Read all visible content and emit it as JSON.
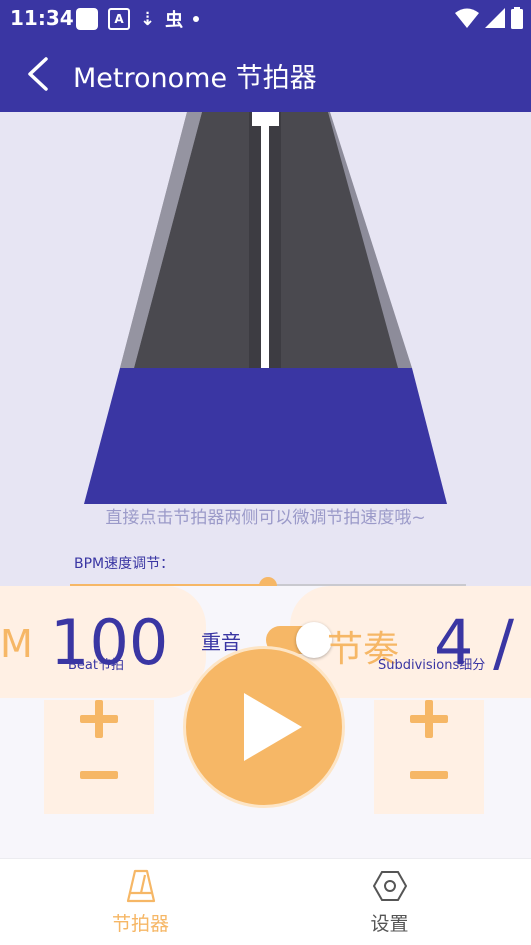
{
  "status_bar": {
    "time": "11:34",
    "a_badge": "A",
    "download_glyph": "⇣",
    "bug_glyph": "虫"
  },
  "app_bar": {
    "title": "Metronome 节拍器"
  },
  "hint": "直接点击节拍器两侧可以微调节拍速度哦~",
  "bpm_slider": {
    "label": "BPM速度调节：",
    "value": 0.5
  },
  "tempo": {
    "unit": "M",
    "value": "100",
    "label": "Beat节拍"
  },
  "accent": {
    "label": "重音",
    "enabled": true
  },
  "rhythm": {
    "label": "节奏",
    "value": "4 /",
    "sub_label": "Subdivisions细分"
  },
  "nav": [
    {
      "label": "节拍器",
      "icon": "metronome-icon",
      "active": true
    },
    {
      "label": "设置",
      "icon": "settings-hex-icon",
      "active": false
    }
  ],
  "colors": {
    "primary": "#3a36a3",
    "accent": "#f6b766",
    "card": "#fff0e4",
    "metronome_bg": "#e7e5f3"
  }
}
